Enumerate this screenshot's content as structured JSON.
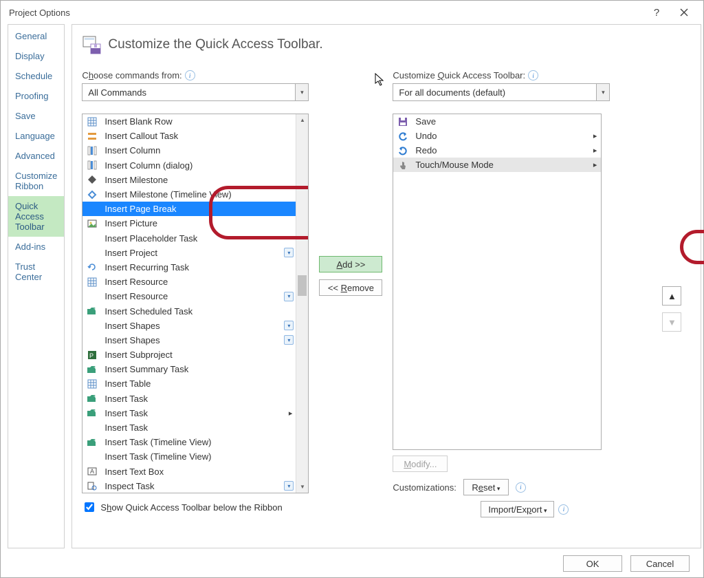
{
  "window": {
    "title": "Project Options",
    "help_btn": "?",
    "close_btn": "×"
  },
  "nav": {
    "items": [
      {
        "label": "General"
      },
      {
        "label": "Display"
      },
      {
        "label": "Schedule"
      },
      {
        "label": "Proofing"
      },
      {
        "label": "Save"
      },
      {
        "label": "Language"
      },
      {
        "label": "Advanced"
      },
      {
        "label": "Customize Ribbon"
      },
      {
        "label": "Quick Access Toolbar",
        "selected": true
      },
      {
        "label": "Add-ins"
      },
      {
        "label": "Trust Center"
      }
    ]
  },
  "header": {
    "title": "Customize the Quick Access Toolbar."
  },
  "left": {
    "choose_label_pre": "C",
    "choose_label_u": "h",
    "choose_label_post": "oose commands from:",
    "combo_value": "All Commands"
  },
  "right": {
    "cust_label_pre": "Customize ",
    "cust_label_u": "Q",
    "cust_label_post": "uick Access Toolbar:",
    "combo_value": "For all documents (default)"
  },
  "commands": [
    {
      "label": "Insert Blank Row",
      "icon": "grid"
    },
    {
      "label": "Insert Callout Task",
      "icon": "bars"
    },
    {
      "label": "Insert Column",
      "icon": "col"
    },
    {
      "label": "Insert Column (dialog)",
      "icon": "col"
    },
    {
      "label": "Insert Milestone",
      "icon": "diamond"
    },
    {
      "label": "Insert Milestone (Timeline View)",
      "icon": "diamond2"
    },
    {
      "label": "Insert Page Break",
      "selected": true
    },
    {
      "label": "Insert Picture",
      "icon": "pic"
    },
    {
      "label": "Insert Placeholder Task"
    },
    {
      "label": "Insert Project",
      "flyout": true
    },
    {
      "label": "Insert Recurring Task",
      "icon": "rec"
    },
    {
      "label": "Insert Resource",
      "icon": "grid"
    },
    {
      "label": "Insert Resource",
      "flyout": true
    },
    {
      "label": "Insert Scheduled Task",
      "icon": "folder-add"
    },
    {
      "label": "Insert Shapes",
      "flyout": true
    },
    {
      "label": "Insert Shapes",
      "flyout": true
    },
    {
      "label": "Insert Subproject",
      "icon": "proj"
    },
    {
      "label": "Insert Summary Task",
      "icon": "folder-add"
    },
    {
      "label": "Insert Table",
      "icon": "grid"
    },
    {
      "label": "Insert Task",
      "icon": "folder-add"
    },
    {
      "label": "Insert Task",
      "icon": "folder-add",
      "sub": true
    },
    {
      "label": "Insert Task"
    },
    {
      "label": "Insert Task (Timeline View)",
      "icon": "folder-add"
    },
    {
      "label": "Insert Task (Timeline View)"
    },
    {
      "label": "Insert Text Box",
      "icon": "text"
    },
    {
      "label": "Inspect Task",
      "icon": "inspect",
      "flyout": true
    }
  ],
  "qat_items": [
    {
      "label": "Save",
      "icon": "save"
    },
    {
      "label": "Undo",
      "icon": "undo",
      "sub": true
    },
    {
      "label": "Redo",
      "icon": "redo",
      "sub": true
    },
    {
      "label": "Touch/Mouse Mode",
      "icon": "touch",
      "sub": true,
      "selected": true
    }
  ],
  "buttons": {
    "add": "Add >>",
    "remove_pre": "<< ",
    "remove_u": "R",
    "remove_post": "emove",
    "modify_u": "M",
    "modify_post": "odify...",
    "reset": "Reset",
    "import_export": "Import/Export",
    "ok": "OK",
    "cancel": "Cancel",
    "move_up": "▲",
    "move_down": "▼"
  },
  "checkbox": {
    "pre": "S",
    "u": "h",
    "post": "ow Quick Access Toolbar below the Ribbon"
  },
  "labels": {
    "customizations": "Customizations:"
  }
}
